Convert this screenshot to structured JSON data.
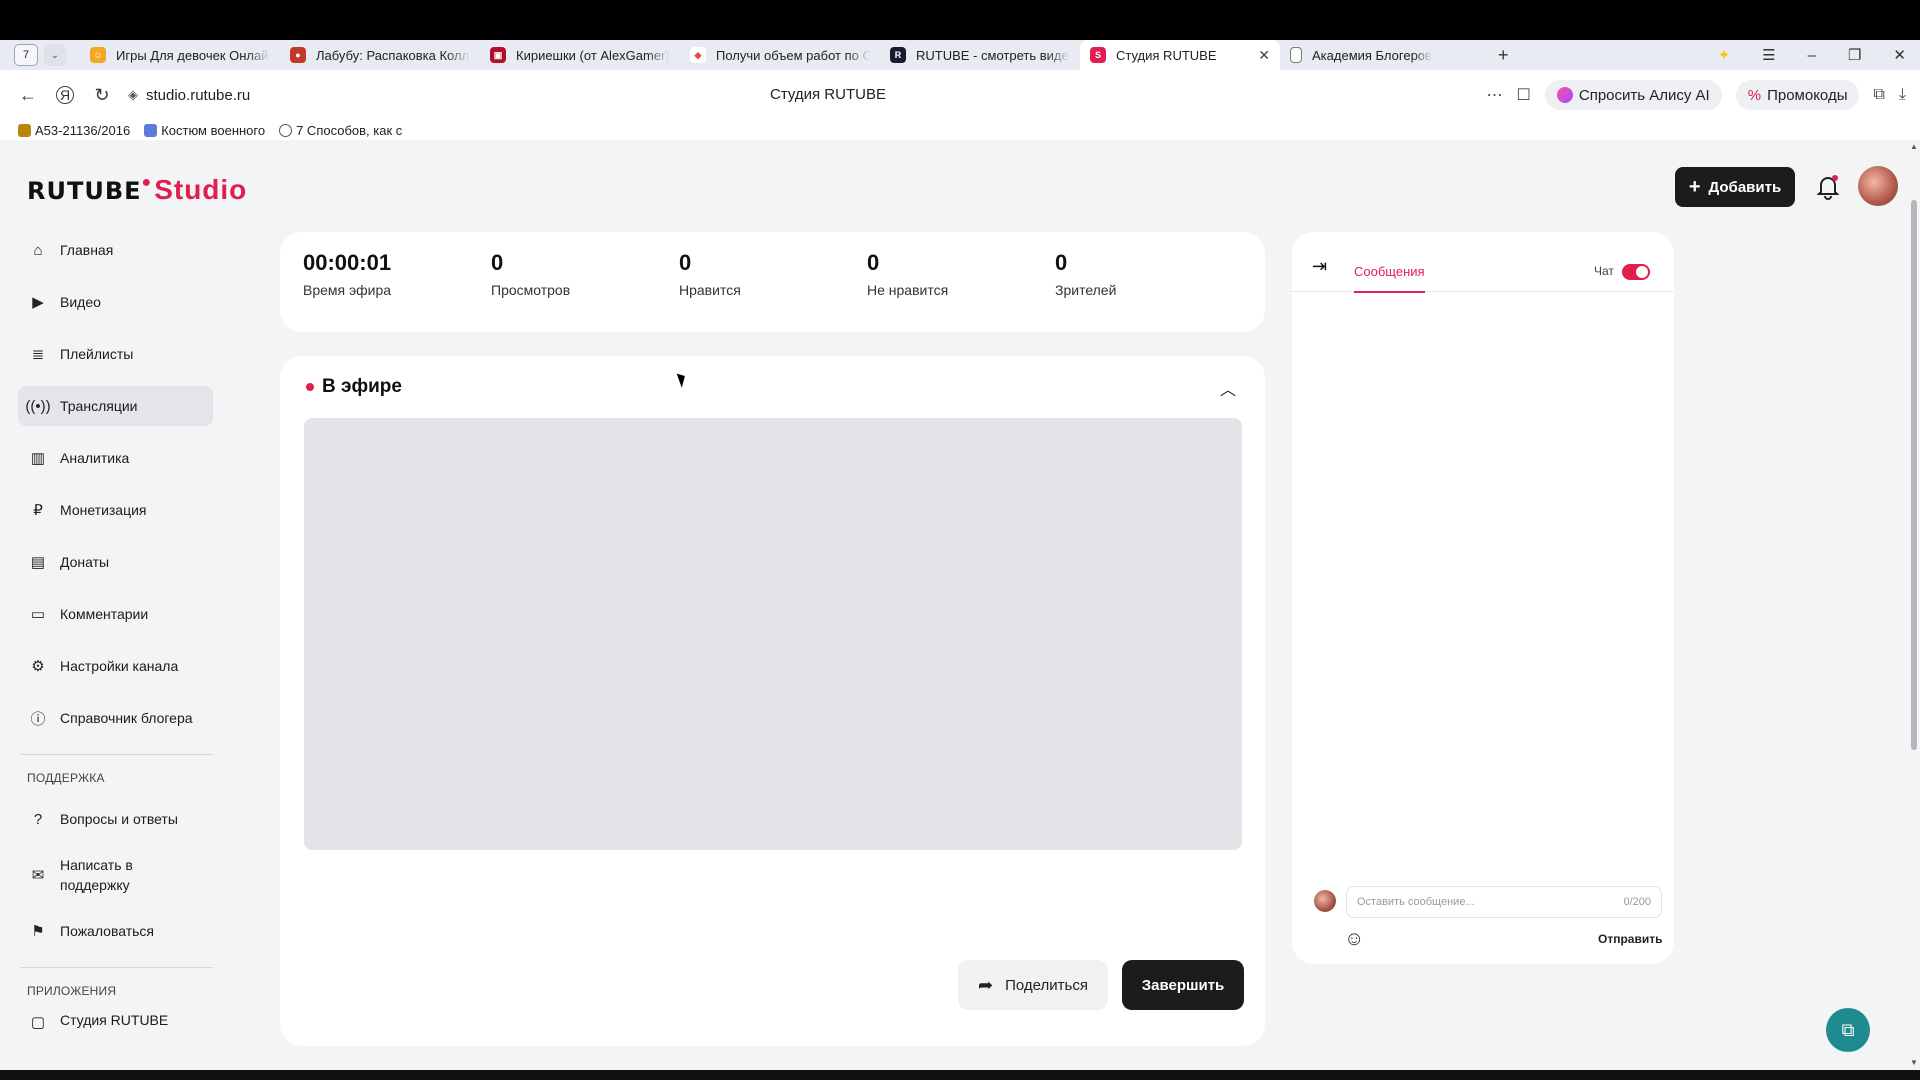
{
  "browser": {
    "tab_counter": "7",
    "tabs": [
      {
        "title": "Игры Для девочек Онлайн",
        "color": "#f5a623"
      },
      {
        "title": "Лабубу: Распаковка Коллекции",
        "color": "#c0392b"
      },
      {
        "title": "Кириешки (от AlexGamer)",
        "color": "#b0102b"
      },
      {
        "title": "Получи объем работ по С",
        "color": "#e74c3c"
      },
      {
        "title": "RUTUBE - смотреть видео",
        "color": "#1a1a2e"
      },
      {
        "title": "Студия RUTUBE",
        "color": "#e01e4f",
        "active": true
      },
      {
        "title": "Академия Блогеров",
        "color": "#666666"
      }
    ],
    "url": "studio.rutube.ru",
    "page_title": "Студия RUTUBE",
    "alice_label": "Спросить Алису AI",
    "promo_label": "Промокоды",
    "bookmarks": [
      "А53-21136/2016",
      "Костюм военного",
      "7 Способов, как с"
    ]
  },
  "header": {
    "logo_left": "RUTUBE",
    "logo_right": "Studio",
    "add_label": "Добавить"
  },
  "sidebar": {
    "items": [
      {
        "label": "Главная",
        "icon": "home-icon"
      },
      {
        "label": "Видео",
        "icon": "video-icon"
      },
      {
        "label": "Плейлисты",
        "icon": "playlist-icon"
      },
      {
        "label": "Трансляции",
        "icon": "broadcast-icon",
        "active": true
      },
      {
        "label": "Аналитика",
        "icon": "analytics-icon"
      },
      {
        "label": "Монетизация",
        "icon": "ruble-icon"
      },
      {
        "label": "Донаты",
        "icon": "wallet-icon"
      },
      {
        "label": "Комментарии",
        "icon": "comment-icon"
      },
      {
        "label": "Настройки канала",
        "icon": "gear-icon"
      },
      {
        "label": "Справочник блогера",
        "icon": "info-icon"
      }
    ],
    "support_heading": "ПОДДЕРЖКА",
    "support_items": [
      {
        "label": "Вопросы и ответы",
        "icon": "question-icon"
      },
      {
        "label": "Написать в поддержку",
        "icon": "mail-icon"
      },
      {
        "label": "Пожаловаться",
        "icon": "flag-icon"
      }
    ],
    "apps_heading": "ПРИЛОЖЕНИЯ",
    "apps_partial": "Студия RUTUBE"
  },
  "stats": [
    {
      "value": "00:00:01",
      "label": "Время эфира"
    },
    {
      "value": "0",
      "label": "Просмотров"
    },
    {
      "value": "0",
      "label": "Нравится"
    },
    {
      "value": "0",
      "label": "Не нравится"
    },
    {
      "value": "0",
      "label": "Зрителей"
    }
  ],
  "live": {
    "title": "В эфире",
    "share_label": "Поделиться",
    "end_label": "Завершить"
  },
  "chat": {
    "tab_label": "Сообщения",
    "toggle_label": "Чат",
    "input_placeholder": "Оставить сообщение...",
    "counter": "0/200",
    "send_label": "Отправить"
  },
  "colors": {
    "accent": "#e01e4f",
    "dark": "#1c1c1e"
  }
}
